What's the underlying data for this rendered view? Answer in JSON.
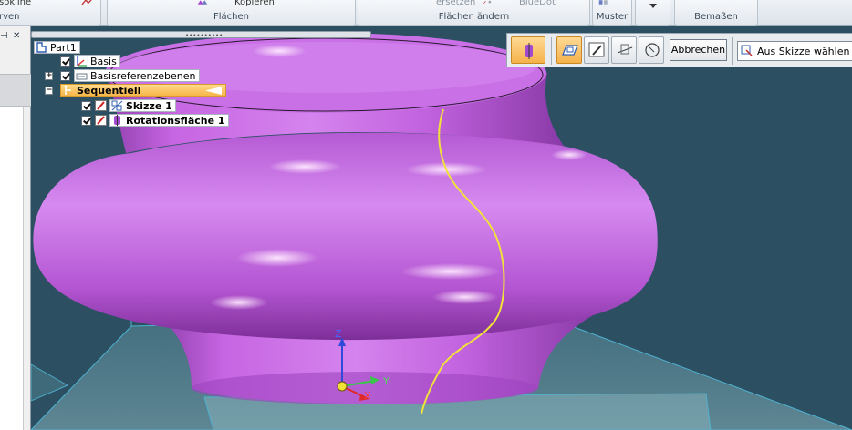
{
  "ribbon": {
    "groups": [
      {
        "id": "kurven",
        "label": "rven",
        "partial_text": "sokline"
      },
      {
        "id": "flaechen",
        "label": "Flächen",
        "partial_text": "Kopieren"
      },
      {
        "id": "flaechen-aendern",
        "label": "Flächen ändern",
        "partial_text_1": "ersetzen",
        "partial_text_2": "BlueDot"
      },
      {
        "id": "muster",
        "label": "Muster"
      },
      {
        "id": "bemassen",
        "label": "Bemaßen"
      }
    ]
  },
  "tree": {
    "items": [
      {
        "label": "Part1",
        "icon": "part-icon",
        "checked": false,
        "expander": ""
      },
      {
        "label": "Basis",
        "icon": "coordinate-system-icon",
        "checked": true,
        "expander": ""
      },
      {
        "label": "Basisreferenzebenen",
        "icon": "reference-planes-icon",
        "checked": true,
        "expander": "+"
      },
      {
        "label": "Sequentiell",
        "icon": "sequential-icon",
        "checked": false,
        "expander": "−"
      },
      {
        "label": "Skizze 1",
        "icon": "sketch-icon",
        "checked": true,
        "expander": ""
      },
      {
        "label": "Rotationsfläche 1",
        "icon": "revolved-surface-icon",
        "checked": true,
        "expander": ""
      }
    ]
  },
  "command_bar": {
    "cancel_label": "Abbrechen",
    "select_value": "Aus Skizze wählen"
  },
  "axes": {
    "z": "Z",
    "y": "Y",
    "x": "X"
  },
  "colors": {
    "viewport_bg": "#2c5062",
    "surface": "#c466e0",
    "sketch_curve": "#f1e23a",
    "highlight": "#f7b64a"
  }
}
